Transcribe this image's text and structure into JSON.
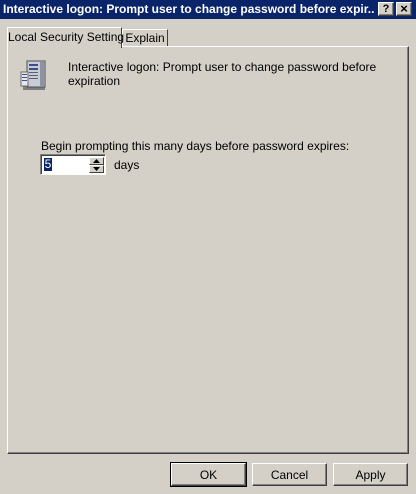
{
  "window": {
    "title": "Interactive logon: Prompt user to change password before expir...",
    "help_label": "?",
    "close_label": "×"
  },
  "tabs": [
    {
      "label": "Local Security Setting",
      "active": true
    },
    {
      "label": "Explain",
      "active": false
    }
  ],
  "policy": {
    "icon": "server-policy-icon",
    "name": "Interactive logon: Prompt user to change password before expiration"
  },
  "setting": {
    "prompt_label": "Begin prompting this many days before password expires:",
    "days_value": "5",
    "days_unit": "days"
  },
  "buttons": {
    "ok": "OK",
    "cancel": "Cancel",
    "apply": "Apply"
  },
  "colors": {
    "title_bar": "#0a246a",
    "face": "#d4d0c8",
    "selection": "#0a246a"
  }
}
